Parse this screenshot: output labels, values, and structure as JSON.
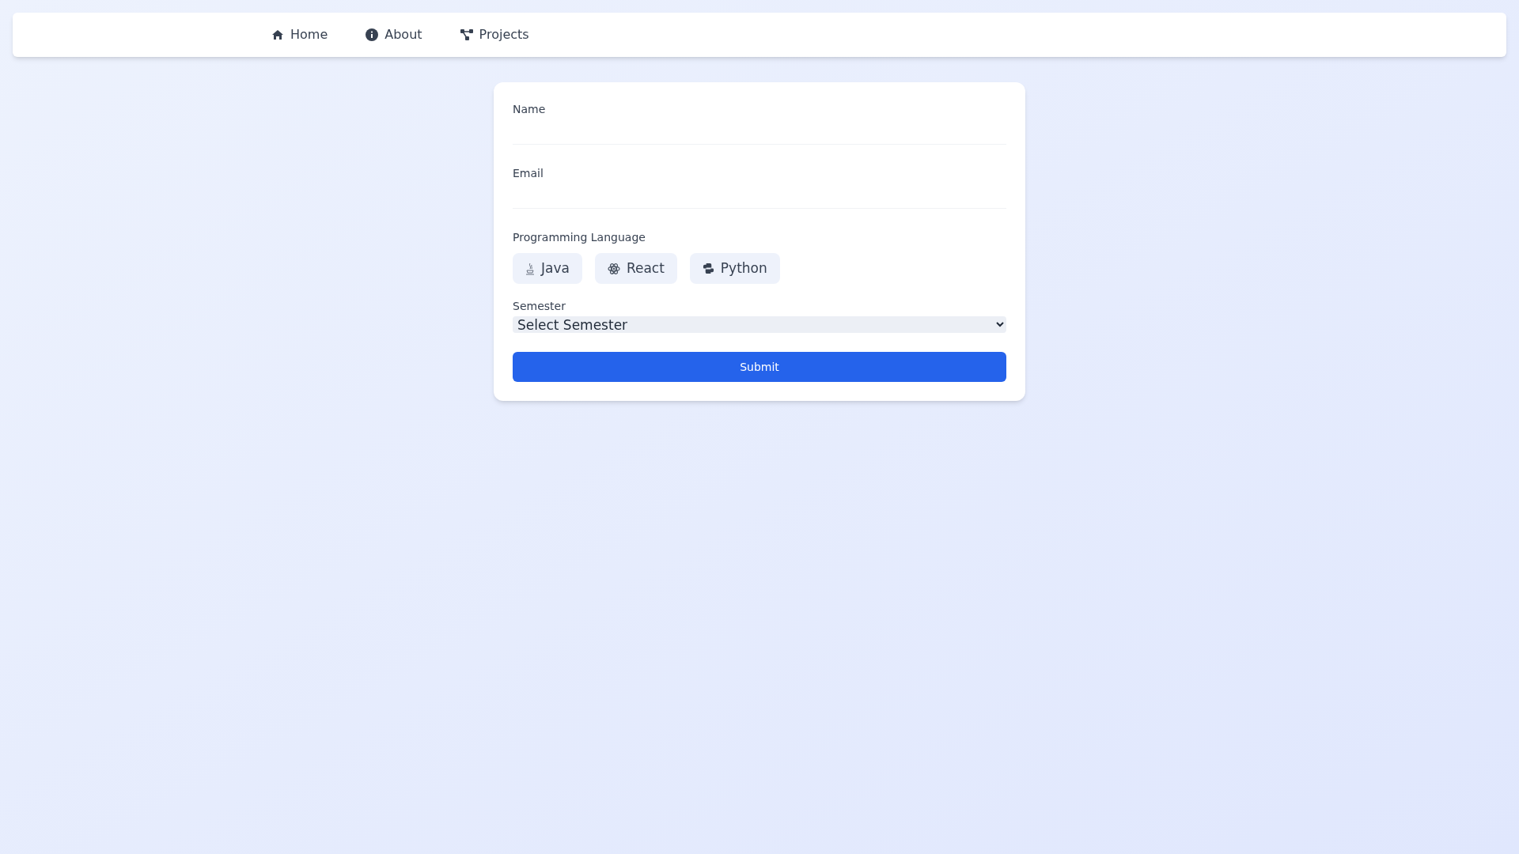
{
  "nav": {
    "items": [
      {
        "label": "Home"
      },
      {
        "label": "About"
      },
      {
        "label": "Projects"
      }
    ]
  },
  "form": {
    "fields": [
      {
        "label": "Name"
      },
      {
        "label": "Email"
      }
    ],
    "language": {
      "label": "Programming Language",
      "options": [
        {
          "label": "Java"
        },
        {
          "label": "React"
        },
        {
          "label": "Python"
        }
      ]
    },
    "semester": {
      "label": "Semester",
      "value": "Select Semester"
    },
    "submit": "Submit"
  }
}
